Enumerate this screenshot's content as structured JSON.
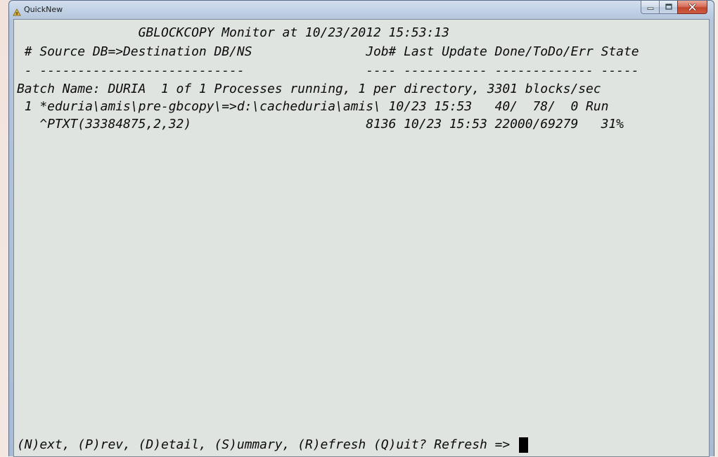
{
  "window": {
    "title": "QuickNew"
  },
  "console": {
    "lines": [
      "                GBLOCKCOPY Monitor at 10/23/2012 15:53:13",
      " # Source DB=>Destination DB/NS               Job# Last Update Done/ToDo/Err State",
      " - ---------------------------                ---- ----------- ------------- -----",
      "Batch Name: DURIA  1 of 1 Processes running, 1 per directory, 3301 blocks/sec",
      " 1 *eduria\\amis\\pre-gbcopy\\=>d:\\cacheduria\\amis\\ 10/23 15:53   40/  78/  0 Run",
      "   ^PTXT(33384875,2,32)                       8136 10/23 15:53 22000/69279   31%"
    ],
    "prompt": "(N)ext, (P)rev, (D)etail, (S)ummary, (R)efresh (Q)uit? Refresh => "
  },
  "icons": {
    "app": "console-app-icon",
    "minimize": "minimize-icon",
    "maximize": "maximize-icon",
    "close": "close-icon"
  },
  "colors": {
    "console_bg": "#dfe4e1",
    "console_fg": "#0b0b0b",
    "close_button": "#c2472f"
  }
}
